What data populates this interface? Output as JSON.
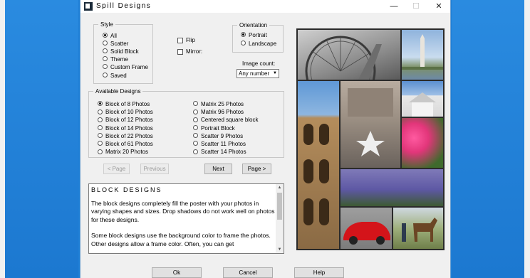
{
  "window": {
    "title": "Spill Designs",
    "minimize": "—",
    "maximize": "☐",
    "close": "✕"
  },
  "style": {
    "legend": "Style",
    "options": [
      "All",
      "Scatter",
      "Solid Block",
      "Theme",
      "Custom Frame",
      "Saved"
    ],
    "selected": "All"
  },
  "flip": {
    "label": "Flip",
    "checked": false
  },
  "mirror": {
    "label": "Mirror:",
    "checked": false
  },
  "orientation": {
    "legend": "Orientation",
    "options": [
      "Portrait",
      "Landscape"
    ],
    "selected": "Portrait"
  },
  "image_count": {
    "label": "Image count:",
    "value": "Any number"
  },
  "designs": {
    "legend": "Available Designs",
    "col1": [
      "Block of 8 Photos",
      "Block of 10 Photos",
      "Block of 12 Photos",
      "Block of 14 Photos",
      "Block of 22 Photos",
      "Block of 61 Photos",
      "Matrix 20 Photos"
    ],
    "col2": [
      "Matrix 25 Photos",
      "Matrix 96 Photos",
      "Centered square block",
      "Portrait Block",
      "Scatter 9 Photos",
      "Scatter 11 Photos",
      "Scatter 14 Photos"
    ],
    "selected": "Block of 8 Photos"
  },
  "nav": {
    "prev_page": "< Page",
    "previous": "Previous",
    "next": "Next",
    "next_page": "Page >"
  },
  "description": {
    "heading": "BLOCK DESIGNS",
    "p1": "The block designs completely fill the poster with your photos in varying shapes and sizes.  Drop shadows do not work well on photos for these designs.",
    "p2": "Some block designs use the background color to frame the photos.  Other designs allow a frame color.  Often, you can get"
  },
  "footer": {
    "ok": "Ok",
    "cancel": "Cancel",
    "help": "Help"
  },
  "colors": {
    "desktop": "#1f7fd6",
    "dialog": "#f0f0f0",
    "frame": "#2a2a2a"
  }
}
